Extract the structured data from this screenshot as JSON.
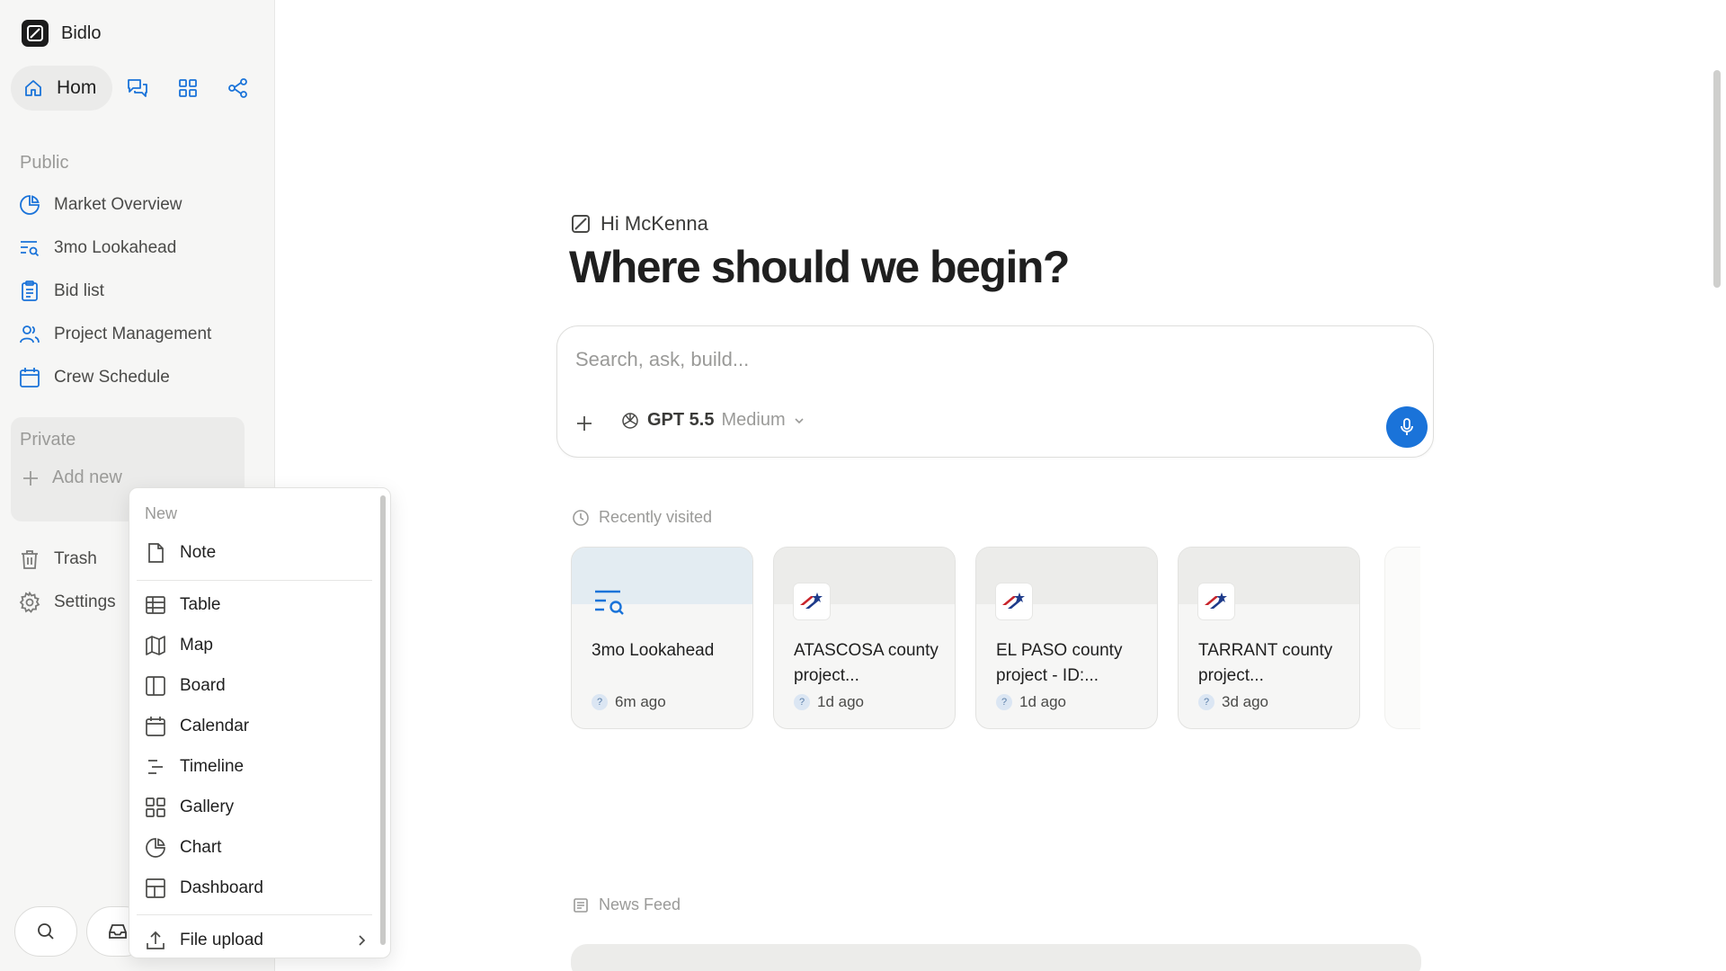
{
  "app": {
    "name": "Bidlo"
  },
  "sidebar": {
    "home_label": "Hom",
    "public_label": "Public",
    "public_items": [
      {
        "label": "Market Overview",
        "icon": "pie-chart-icon"
      },
      {
        "label": "3mo Lookahead",
        "icon": "list-search-icon"
      },
      {
        "label": "Bid list",
        "icon": "clipboard-icon"
      },
      {
        "label": "Project Management",
        "icon": "users-icon"
      },
      {
        "label": "Crew Schedule",
        "icon": "calendar-icon"
      }
    ],
    "private_label": "Private",
    "add_new_label": "Add new",
    "trash_label": "Trash",
    "settings_label": "Settings"
  },
  "menu": {
    "header": "New",
    "items": [
      {
        "label": "Note",
        "icon": "note-icon"
      },
      {
        "label": "Table",
        "icon": "table-icon"
      },
      {
        "label": "Map",
        "icon": "map-icon"
      },
      {
        "label": "Board",
        "icon": "board-icon"
      },
      {
        "label": "Calendar",
        "icon": "calendar-icon"
      },
      {
        "label": "Timeline",
        "icon": "timeline-icon"
      },
      {
        "label": "Gallery",
        "icon": "gallery-icon"
      },
      {
        "label": "Chart",
        "icon": "chart-icon"
      },
      {
        "label": "Dashboard",
        "icon": "dashboard-icon"
      },
      {
        "label": "File upload",
        "icon": "upload-icon"
      }
    ]
  },
  "main": {
    "greeting": "Hi McKenna",
    "headline": "Where should we begin?",
    "search_placeholder": "Search, ask, build...",
    "model_name": "GPT 5.5",
    "model_mode": "Medium",
    "recently_visited_label": "Recently visited",
    "news_feed_label": "News Feed",
    "recent_cards": [
      {
        "title": "3mo Lookahead",
        "time": "6m ago"
      },
      {
        "title": "ATASCOSA county project...",
        "time": "1d ago"
      },
      {
        "title": "EL PASO county project - ID:...",
        "time": "1d ago"
      },
      {
        "title": "TARRANT county project...",
        "time": "3d ago"
      }
    ],
    "card_avatar_char": "?"
  },
  "colors": {
    "accent": "#1a73d9",
    "sidebar_bg": "#f6f6f5",
    "card_banner_blue": "#e3ecf2",
    "card_banner_gray": "#ececea"
  }
}
